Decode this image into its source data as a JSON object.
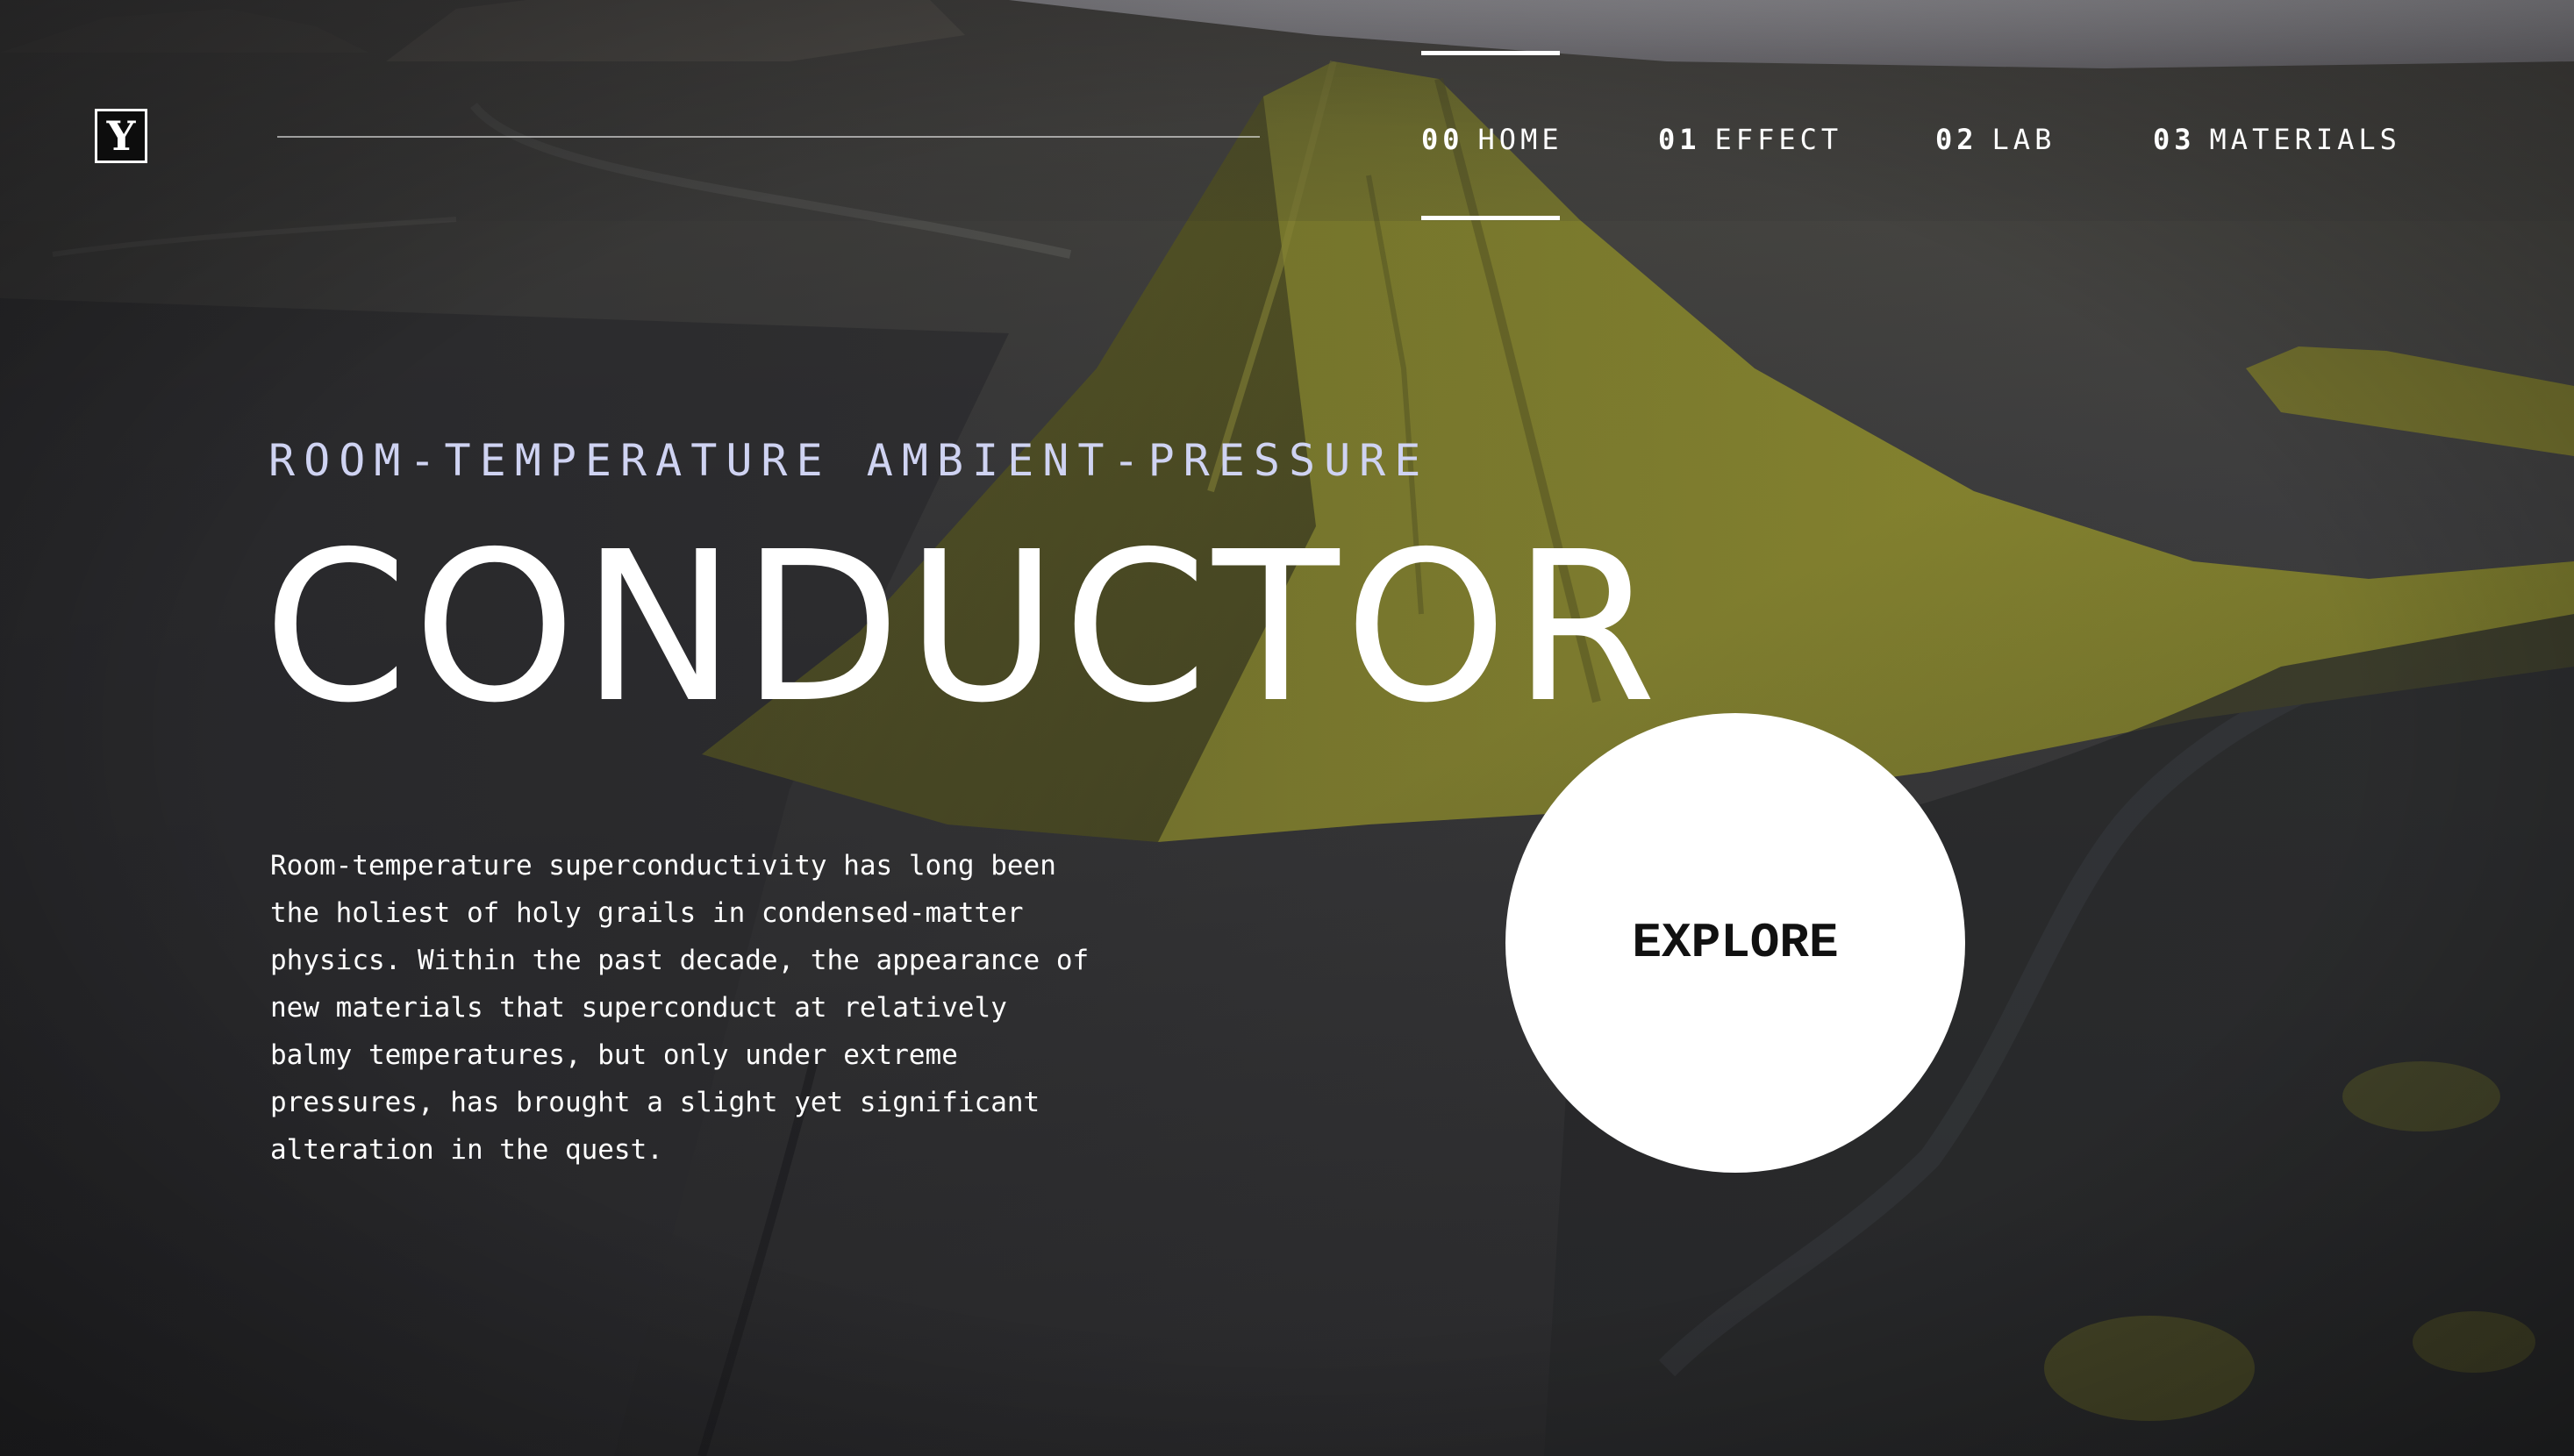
{
  "brand": {
    "logo_letter": "Y"
  },
  "nav": {
    "items": [
      {
        "num": "00",
        "label": "HOME",
        "active": true
      },
      {
        "num": "01",
        "label": "EFFECT",
        "active": false
      },
      {
        "num": "02",
        "label": "LAB",
        "active": false
      },
      {
        "num": "03",
        "label": "MATERIALS",
        "active": false
      }
    ]
  },
  "hero": {
    "kicker": "ROOM-TEMPERATURE AMBIENT-PRESSURE",
    "title": "CONDUCTOR",
    "body_lines": [
      "Room-temperature superconductivity has long been",
      "the holiest of holy grails in condensed-matter",
      "physics. Within the past decade, the appearance of",
      "new materials that superconduct at relatively",
      "balmy temperatures, but only under extreme",
      "pressures, has brought a slight yet significant",
      "alteration in the quest."
    ],
    "cta_label": "EXPLORE"
  },
  "colors": {
    "kicker": "#cfd3f2",
    "text": "#ffffff",
    "cta_bg": "#ffffff",
    "cta_text": "#111111",
    "mountain": "#7d7a2a",
    "ground": "#3a3a3c"
  },
  "background": {
    "icon": "volcanic-mountain-aerial-photo"
  }
}
